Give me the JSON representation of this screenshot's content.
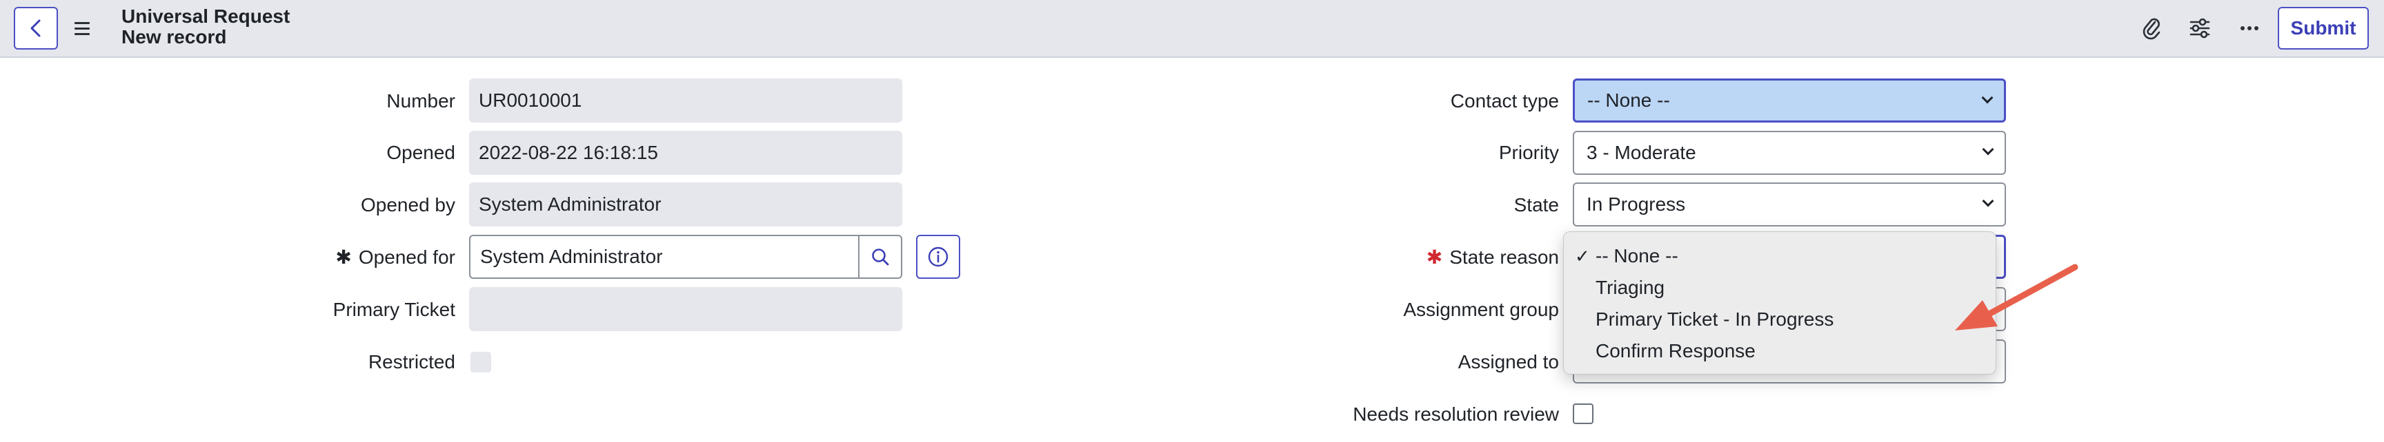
{
  "header": {
    "title": "Universal Request",
    "subtitle": "New record",
    "submit_label": "Submit",
    "icons": [
      "back-icon",
      "menu-icon",
      "paperclip-icon",
      "settings-sliders-icon",
      "more-icon"
    ]
  },
  "form": {
    "left": {
      "number_label": "Number",
      "number_value": "UR0010001",
      "opened_label": "Opened",
      "opened_value": "2022-08-22 16:18:15",
      "opened_by_label": "Opened by",
      "opened_by_value": "System Administrator",
      "opened_for_label": "Opened for",
      "opened_for_value": "System Administrator",
      "primary_ticket_label": "Primary Ticket",
      "primary_ticket_value": "",
      "restricted_label": "Restricted"
    },
    "right": {
      "contact_type_label": "Contact type",
      "contact_type_value": "-- None --",
      "priority_label": "Priority",
      "priority_value": "3 - Moderate",
      "state_label": "State",
      "state_value": "In Progress",
      "state_reason_label": "State reason",
      "assignment_group_label": "Assignment group",
      "assigned_to_label": "Assigned to",
      "needs_resolution_label": "Needs resolution review"
    }
  },
  "state_reason_dropdown": {
    "options": [
      "-- None --",
      "Triaging",
      "Primary Ticket - In Progress",
      "Confirm Response"
    ],
    "selected": "-- None --",
    "check_mark": "✓"
  },
  "colors": {
    "accent": "#4b4fc4",
    "focus_fill": "#bcd6f5",
    "readonly_fill": "#e5e7ec",
    "required_red": "#d0282f",
    "arrow": "#e8604c"
  }
}
